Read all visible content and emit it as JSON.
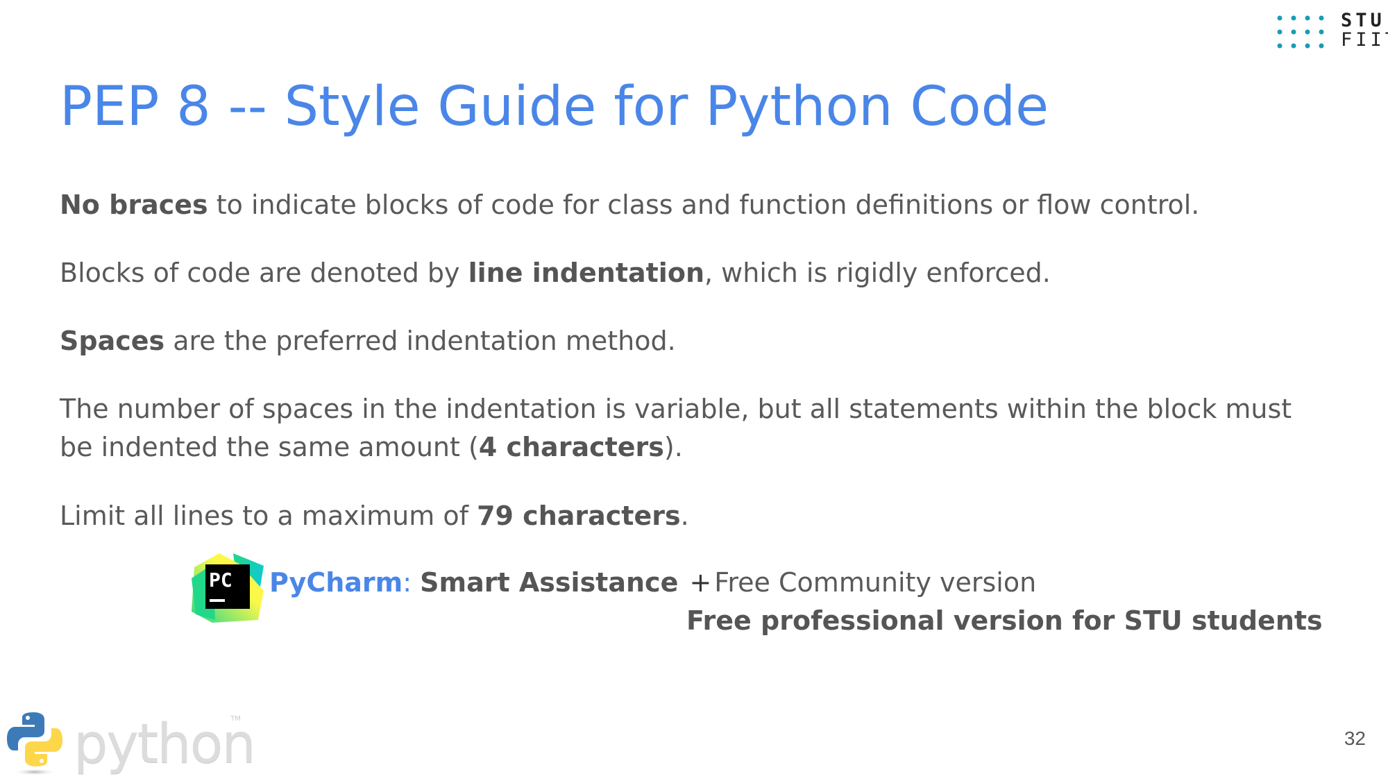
{
  "logo": {
    "line1": "STU",
    "line2": "FIIT",
    "dot_color": "#1a9bb5"
  },
  "title": "PEP 8 -- Style Guide for Python Code",
  "paragraphs": {
    "p1": {
      "bold": "No braces",
      "rest": " to indicate blocks of code for class and function definitions or flow control."
    },
    "p2": {
      "before": "Blocks of code are denoted by ",
      "bold": "line indentation",
      "after": ", which is rigidly enforced."
    },
    "p3": {
      "bold": "Spaces",
      "rest": " are the preferred indentation method."
    },
    "p4": {
      "before": "The number of spaces in the indentation is variable, but all statements within the block must be indented the same amount (",
      "bold": "4 characters",
      "after": ")."
    },
    "p5": {
      "before": "Limit all lines to a maximum of ",
      "bold": "79 characters",
      "after": "."
    }
  },
  "pycharm": {
    "icon_text": "PC",
    "name": "PyCharm",
    "separator": ":",
    "smart": "Smart Assistance",
    "plus": "+",
    "community": "Free Community version",
    "professional": "Free professional version for STU students"
  },
  "python_logo": {
    "wordmark": "python",
    "tm": "TM"
  },
  "page_number": "32",
  "colors": {
    "accent": "#4a86e8",
    "body_text": "#595959"
  }
}
